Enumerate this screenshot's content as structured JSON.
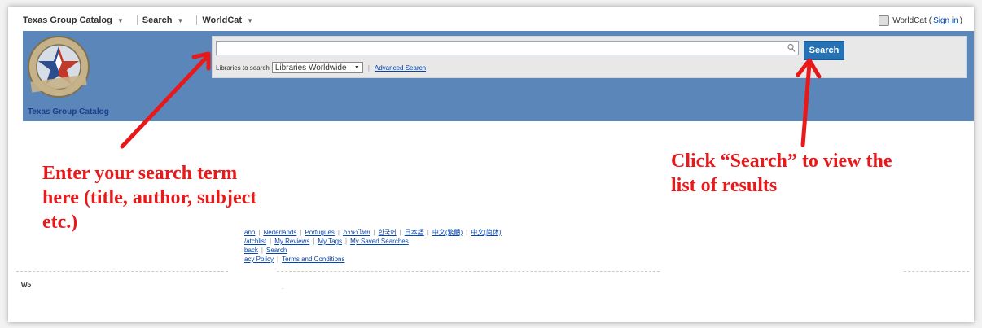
{
  "nav": {
    "catalog_label": "Texas Group Catalog",
    "search_label": "Search",
    "worldcat_label": "WorldCat",
    "account_text": "WorldCat",
    "sign_in_open": "(",
    "sign_in_label": "Sign in",
    "sign_in_close": ")"
  },
  "banner": {
    "logo_text_top": "TEXAS",
    "logo_text_bottom": "GROUP CATALOG",
    "caption": "Texas Group Catalog",
    "background_color": "#5a86ba"
  },
  "search": {
    "input_value": "",
    "button_label": "Search",
    "libraries_label": "Libraries to search",
    "libraries_selected": "Libraries Worldwide",
    "advanced_label": "Advanced Search"
  },
  "footer": {
    "languages": [
      "ano",
      "Nederlands",
      "Português",
      "ภาษาไทย",
      "한국어",
      "日本語",
      "中文(繁體)",
      "中文(简体)"
    ],
    "account_links": [
      "/atchlist",
      "My Reviews",
      "My Tags",
      "My Saved Searches"
    ],
    "help_links": [
      "back",
      "Search"
    ],
    "legal_links": [
      "acy Policy",
      "Terms and Conditions"
    ],
    "left_fragment": "Wo",
    "dot": "."
  },
  "annotations": {
    "left": "Enter your search term here (title, author, subject etc.)",
    "right": "Click “Search” to view the list of results",
    "color": "#e8191b"
  }
}
